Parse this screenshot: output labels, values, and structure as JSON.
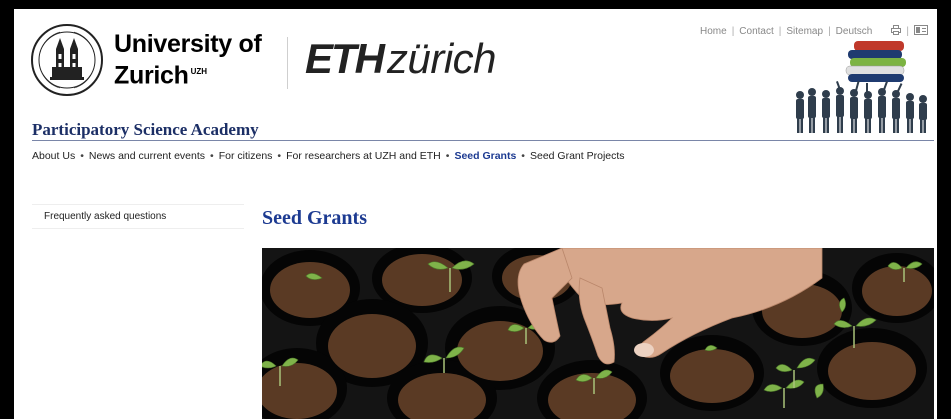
{
  "header": {
    "uzh_name_line1": "University of",
    "uzh_name_line2": "Zurich",
    "uzh_superscript": "UZH",
    "eth_bold": "ETH",
    "eth_rest": "zürich",
    "top_links": [
      "Home",
      "Contact",
      "Sitemap",
      "Deutsch"
    ],
    "icons": [
      "print-icon",
      "accessibility-icon"
    ]
  },
  "site": {
    "title": "Participatory Science Academy"
  },
  "nav": {
    "items": [
      {
        "label": "About Us"
      },
      {
        "label": "News and current events"
      },
      {
        "label": "For citizens"
      },
      {
        "label": "For researchers at UZH and ETH"
      },
      {
        "label": "Seed Grants",
        "active": true
      },
      {
        "label": "Seed Grant Projects"
      }
    ]
  },
  "sidebar": {
    "items": [
      {
        "label": "Frequently asked questions"
      }
    ]
  },
  "main": {
    "heading": "Seed Grants",
    "hero_image": "seedling-tray-photo"
  },
  "colors": {
    "title_blue": "#1c2f66",
    "link_blue": "#1c3a91",
    "tray_black": "#161616",
    "soil_brown": "#5a3a24",
    "leaf_green": "#7fb34a"
  }
}
